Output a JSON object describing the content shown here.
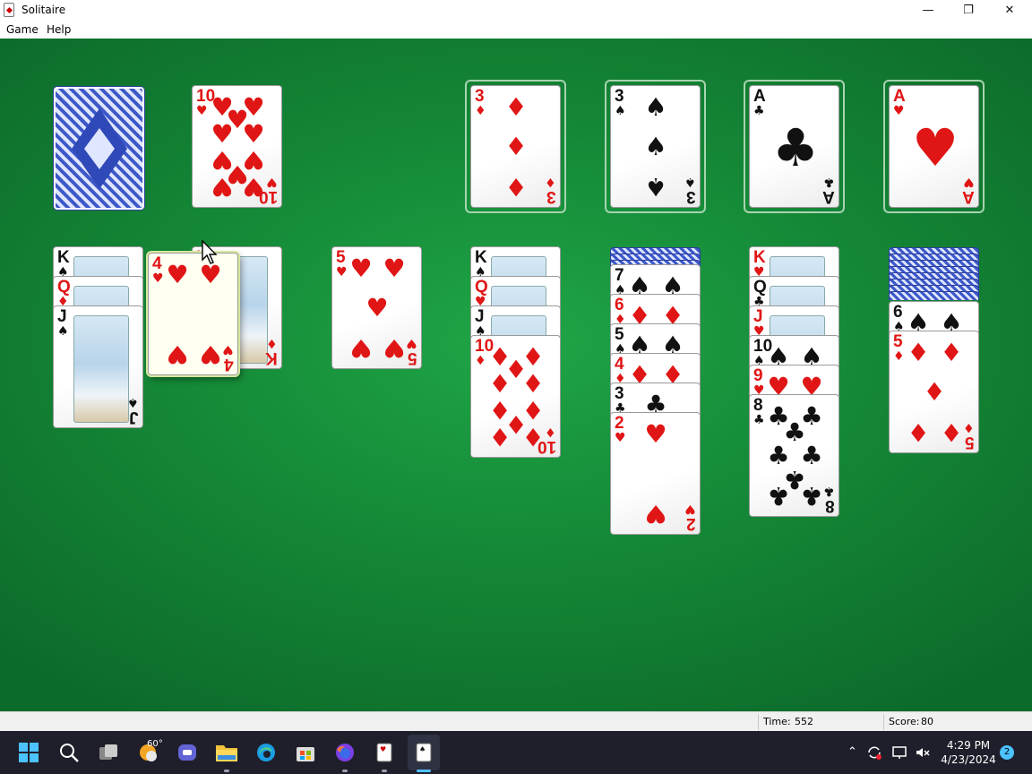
{
  "window": {
    "title": "Solitaire",
    "menu": [
      "Game",
      "Help"
    ],
    "controls": {
      "minimize": "—",
      "maximize": "❐",
      "close": "✕"
    }
  },
  "status": {
    "time_label": "Time:",
    "time_value": "552",
    "score_label": "Score:",
    "score_value": "80"
  },
  "cards": {
    "waste": {
      "rank": "10",
      "suit": "♥"
    },
    "f1": {
      "rank": "3",
      "suit": "♦"
    },
    "f2": {
      "rank": "3",
      "suit": "♠"
    },
    "f3": {
      "rank": "A",
      "suit": "♣"
    },
    "f4": {
      "rank": "A",
      "suit": "♥"
    },
    "t1": [
      {
        "rank": "K",
        "suit": "♠"
      },
      {
        "rank": "Q",
        "suit": "♦"
      },
      {
        "rank": "J",
        "suit": "♠"
      }
    ],
    "t2": {
      "rank": "K",
      "suit": "♦"
    },
    "drag": {
      "rank": "4",
      "suit": "♥"
    },
    "t3": {
      "rank": "5",
      "suit": "♥"
    },
    "t4": [
      {
        "rank": "K",
        "suit": "♠"
      },
      {
        "rank": "Q",
        "suit": "♥"
      },
      {
        "rank": "J",
        "suit": "♠"
      },
      {
        "rank": "10",
        "suit": "♦"
      }
    ],
    "t5": [
      {
        "rank": "7",
        "suit": "♠"
      },
      {
        "rank": "6",
        "suit": "♦"
      },
      {
        "rank": "5",
        "suit": "♠"
      },
      {
        "rank": "4",
        "suit": "♦"
      },
      {
        "rank": "3",
        "suit": "♣"
      },
      {
        "rank": "2",
        "suit": "♥"
      }
    ],
    "t6": [
      {
        "rank": "K",
        "suit": "♥"
      },
      {
        "rank": "Q",
        "suit": "♣"
      },
      {
        "rank": "J",
        "suit": "♥"
      },
      {
        "rank": "10",
        "suit": "♠"
      },
      {
        "rank": "9",
        "suit": "♥"
      },
      {
        "rank": "8",
        "suit": "♣"
      }
    ],
    "t7": [
      {
        "rank": "6",
        "suit": "♠"
      },
      {
        "rank": "5",
        "suit": "♦"
      }
    ]
  },
  "taskbar": {
    "weather": "60°",
    "time": "4:29 PM",
    "date": "4/23/2024",
    "notifications": "2",
    "icons": [
      "windows-start-icon",
      "search-icon",
      "task-view-icon",
      "weather-icon",
      "teams-icon",
      "file-explorer-icon",
      "edge-icon",
      "store-icon",
      "firefox-icon",
      "solitaire-icon",
      "solitaire-active-icon"
    ]
  },
  "colors": {
    "felt": "#158a38",
    "red_suit": "#e01515",
    "black_suit": "#111111",
    "card_back": "#3d58c8"
  }
}
